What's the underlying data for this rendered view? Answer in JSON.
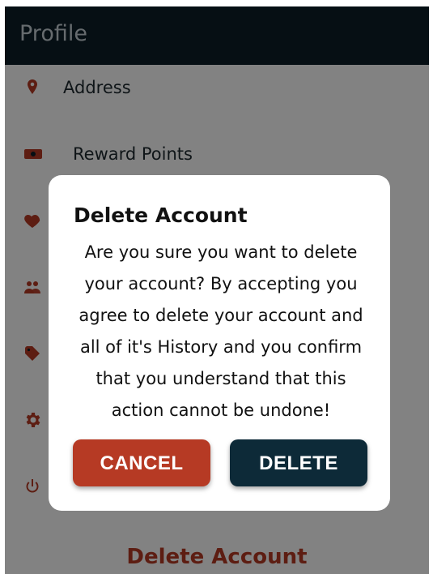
{
  "header": {
    "title": "Profile"
  },
  "menu": {
    "items": [
      {
        "label": "Address",
        "icon": "map-pin-icon"
      },
      {
        "label": "Reward Points",
        "icon": "cash-icon"
      },
      {
        "label": "",
        "icon": "heart-icon"
      },
      {
        "label": "",
        "icon": "users-icon"
      },
      {
        "label": "",
        "icon": "tag-icon"
      },
      {
        "label": "",
        "icon": "gear-icon"
      },
      {
        "label": "",
        "icon": "power-icon"
      }
    ],
    "delete_account_label": "Delete Account"
  },
  "dialog": {
    "title": "Delete Account",
    "message": "Are you sure you want to delete your account? By accepting you agree to delete your account and all of it's History and you confirm that you understand that this action cannot be undone!",
    "cancel_label": "CANCEL",
    "delete_label": "DELETE"
  },
  "colors": {
    "header_bg": "#0d1e28",
    "accent_red": "#b63a24",
    "accent_dark": "#0d2a38",
    "overlay": "rgba(0,0,0,0.49)"
  }
}
